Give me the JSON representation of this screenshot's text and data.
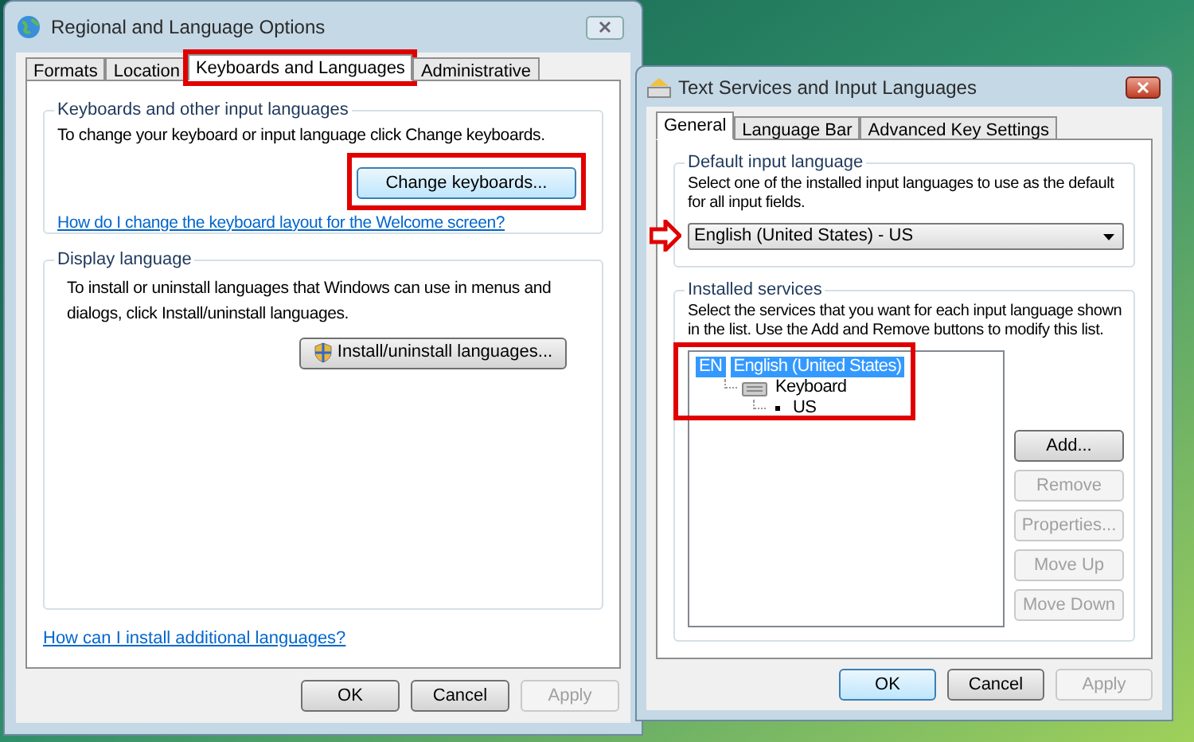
{
  "regional_window": {
    "title": "Regional and Language Options",
    "tabs": [
      {
        "label": "Formats",
        "selected": false,
        "highlighted": false
      },
      {
        "label": "Location",
        "selected": false,
        "highlighted": false
      },
      {
        "label": "Keyboards and Languages",
        "selected": true,
        "highlighted": true
      },
      {
        "label": "Administrative",
        "selected": false,
        "highlighted": false
      }
    ],
    "keyboards_group": {
      "title": "Keyboards and other input languages",
      "text": "To change your keyboard or input language click Change keyboards.",
      "button": {
        "label": "Change keyboards...",
        "highlighted": true
      },
      "link": "How do I change the keyboard layout for the Welcome screen?"
    },
    "display_group": {
      "title": "Display language",
      "text": "To install or uninstall languages that Windows can use in menus and dialogs, click Install/uninstall languages.",
      "button": {
        "label": "Install/uninstall languages...",
        "highlighted": false
      }
    },
    "link": "How can I install additional languages?",
    "buttons": [
      {
        "label": "OK",
        "disabled": false,
        "focused": false
      },
      {
        "label": "Cancel",
        "disabled": false,
        "focused": false
      },
      {
        "label": "Apply",
        "disabled": true,
        "focused": false
      }
    ]
  },
  "text_services_window": {
    "title": "Text Services and Input Languages",
    "tabs": [
      {
        "label": "General",
        "selected": true
      },
      {
        "label": "Language Bar",
        "selected": false
      },
      {
        "label": "Advanced Key Settings",
        "selected": false
      }
    ],
    "default_group": {
      "title": "Default input language",
      "text": "Select one of the installed input languages to use as the default for all input fields.",
      "dropdown": {
        "value": "English (United States) - US",
        "pointer_arrow": true
      }
    },
    "services_group": {
      "title": "Installed services",
      "text": "Select the services that you want for each input language shown in the list. Use the Add and Remove buttons to modify this list.",
      "tree_highlighted": true,
      "tree": [
        {
          "badge": "EN",
          "label": "English (United States)",
          "selected": true,
          "children": [
            {
              "label": "Keyboard",
              "selected": false,
              "children": [
                {
                  "label": "US",
                  "selected": false
                }
              ]
            }
          ]
        }
      ],
      "buttons": [
        {
          "label": "Add...",
          "disabled": false
        },
        {
          "label": "Remove",
          "disabled": true
        },
        {
          "label": "Properties...",
          "disabled": true
        },
        {
          "label": "Move Up",
          "disabled": true
        },
        {
          "label": "Move Down",
          "disabled": true
        }
      ]
    },
    "buttons": [
      {
        "label": "OK",
        "disabled": false,
        "focused": true
      },
      {
        "label": "Cancel",
        "disabled": false,
        "focused": false
      },
      {
        "label": "Apply",
        "disabled": true,
        "focused": false
      }
    ]
  }
}
